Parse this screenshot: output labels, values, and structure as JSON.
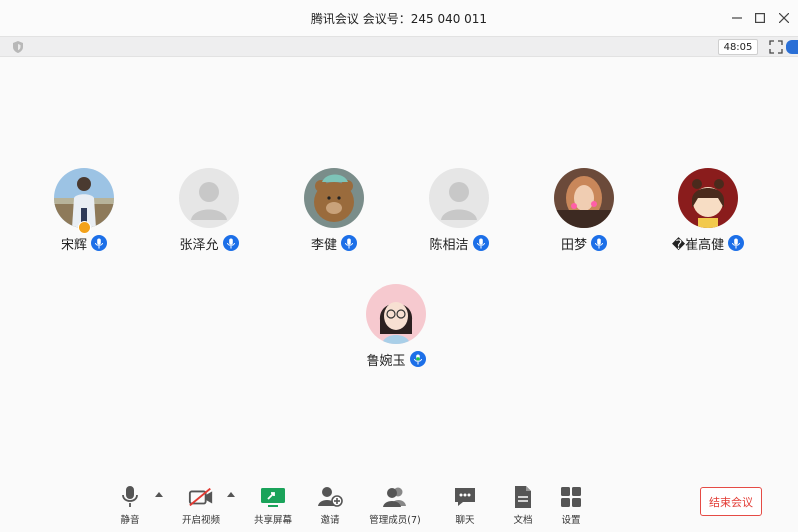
{
  "window": {
    "title": "腾讯会议 会议号：245 040 011"
  },
  "toolbar": {
    "timer": "48:05"
  },
  "participants": [
    {
      "name": "宋辉",
      "mic_color": "#1c6fe8",
      "host": true
    },
    {
      "name": "张泽允",
      "mic_color": "#1c6fe8"
    },
    {
      "name": "李健",
      "mic_color": "#1c6fe8"
    },
    {
      "name": "陈相洁",
      "mic_color": "#1c6fe8"
    },
    {
      "name": "田梦",
      "mic_color": "#1c6fe8"
    },
    {
      "name": "�崔高健",
      "mic_color": "#1c6fe8"
    },
    {
      "name": "鲁婉玉",
      "mic_color": "#1c6fe8",
      "speaking": true
    }
  ],
  "controls": {
    "mute": "静音",
    "video": "开启视频",
    "share": "共享屏幕",
    "invite": "邀请",
    "members": "管理成员(7)",
    "chat": "聊天",
    "docs": "文档",
    "settings": "设置",
    "end": "结束会议"
  },
  "colors": {
    "accent": "#1c6fe8",
    "share_green": "#1aa35a",
    "end_red": "#e23a33",
    "speaking_green": "#1fc34b"
  }
}
